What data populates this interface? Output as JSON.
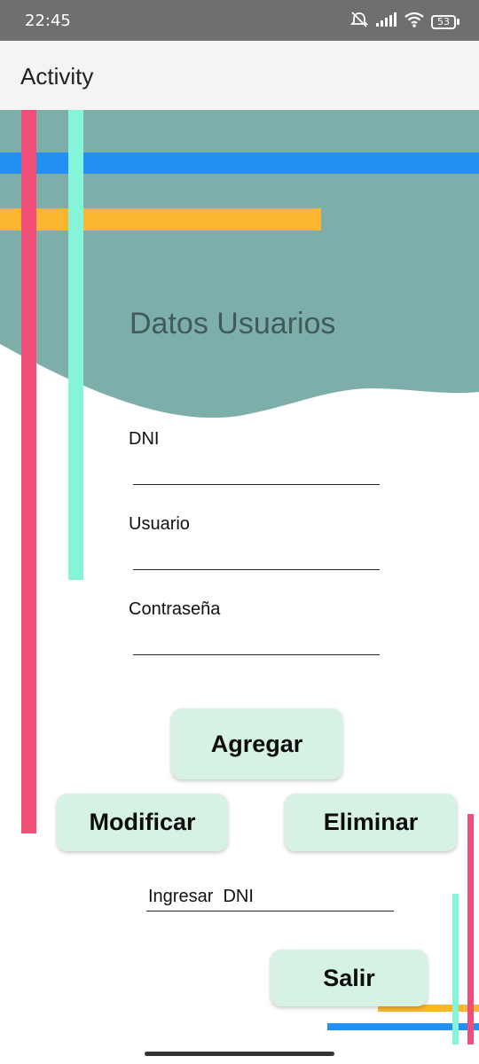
{
  "status_bar": {
    "time": "22:45",
    "battery": "53",
    "icons": [
      "mute-icon",
      "signal-icon",
      "wifi-icon",
      "battery-icon"
    ]
  },
  "app_bar": {
    "title": "Activity"
  },
  "form": {
    "heading": "Datos Usuarios",
    "fields": [
      {
        "label": "DNI",
        "value": ""
      },
      {
        "label": "Usuario",
        "value": ""
      },
      {
        "label": "Contraseña",
        "value": ""
      }
    ]
  },
  "buttons": {
    "add": "Agregar",
    "modify": "Modificar",
    "delete": "Eliminar",
    "exit": "Salir"
  },
  "search": {
    "placeholder": "Ingresar  DNI",
    "value": ""
  },
  "colors": {
    "header_teal": "#7eaeaa",
    "stripe_blue": "#2190f2",
    "stripe_orange": "#fbb52e",
    "stripe_pink": "#f24f78",
    "stripe_mint": "#84f5d9",
    "button_bg": "#d6f2e3"
  }
}
